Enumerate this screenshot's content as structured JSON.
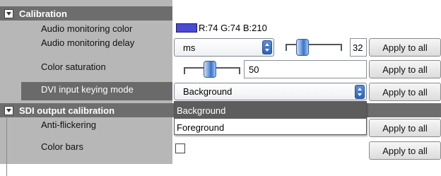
{
  "sections": {
    "calibration": {
      "title": "Calibration"
    },
    "sdi": {
      "title": "SDI output calibration"
    }
  },
  "rows": {
    "audio_color": {
      "label": "Audio monitoring color",
      "value": "R:74 G:74 B:210",
      "swatch_color": "#4a4ad2"
    },
    "audio_delay": {
      "label": "Audio monitoring delay",
      "unit": "ms",
      "value": "32",
      "slider_level": 0.22
    },
    "color_saturation": {
      "label": "Color saturation",
      "value": "50",
      "slider_level": 0.5
    },
    "dvi_keying": {
      "label": "DVI input keying mode",
      "value": "Background"
    },
    "anti_flicker": {
      "label": "Anti-flickering"
    },
    "color_bars": {
      "label": "Color bars"
    }
  },
  "apply_label": "Apply to all",
  "dropdown": {
    "options": [
      "Background",
      "Foreground"
    ],
    "highlighted": "Background"
  }
}
